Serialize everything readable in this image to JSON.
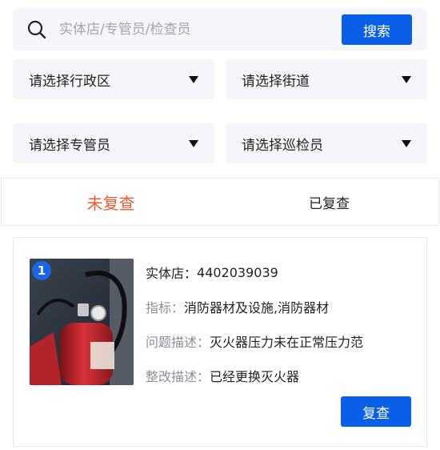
{
  "search": {
    "placeholder": "实体店/专管员/检查员",
    "button_label": "搜索",
    "icon": "search-icon"
  },
  "filters": [
    {
      "label": "请选择行政区",
      "icon": "caret-down-icon"
    },
    {
      "label": "请选择街道",
      "icon": "caret-down-icon"
    },
    {
      "label": "请选择专管员",
      "icon": "caret-down-icon"
    },
    {
      "label": "请选择巡检员",
      "icon": "caret-down-icon"
    }
  ],
  "tabs": [
    {
      "label": "未复查",
      "active": true
    },
    {
      "label": "已复查",
      "active": false
    }
  ],
  "records": [
    {
      "index": "1",
      "store_label": "实体店：",
      "store_value": "4402039039",
      "indicator_label": "指标：",
      "indicator_value": "消防器材及设施,消防器材",
      "problem_label": "问题描述：",
      "problem_value": "灭火器压力未在正常压力范",
      "rectify_label": "整改描述：",
      "rectify_value": "已经更换灭火器",
      "action_label": "复查",
      "image": "fire-extinguisher-photo"
    }
  ],
  "colors": {
    "accent": "#0a5fe8",
    "active_tab": "#f0592f",
    "field_bg": "#f4f6f9"
  }
}
